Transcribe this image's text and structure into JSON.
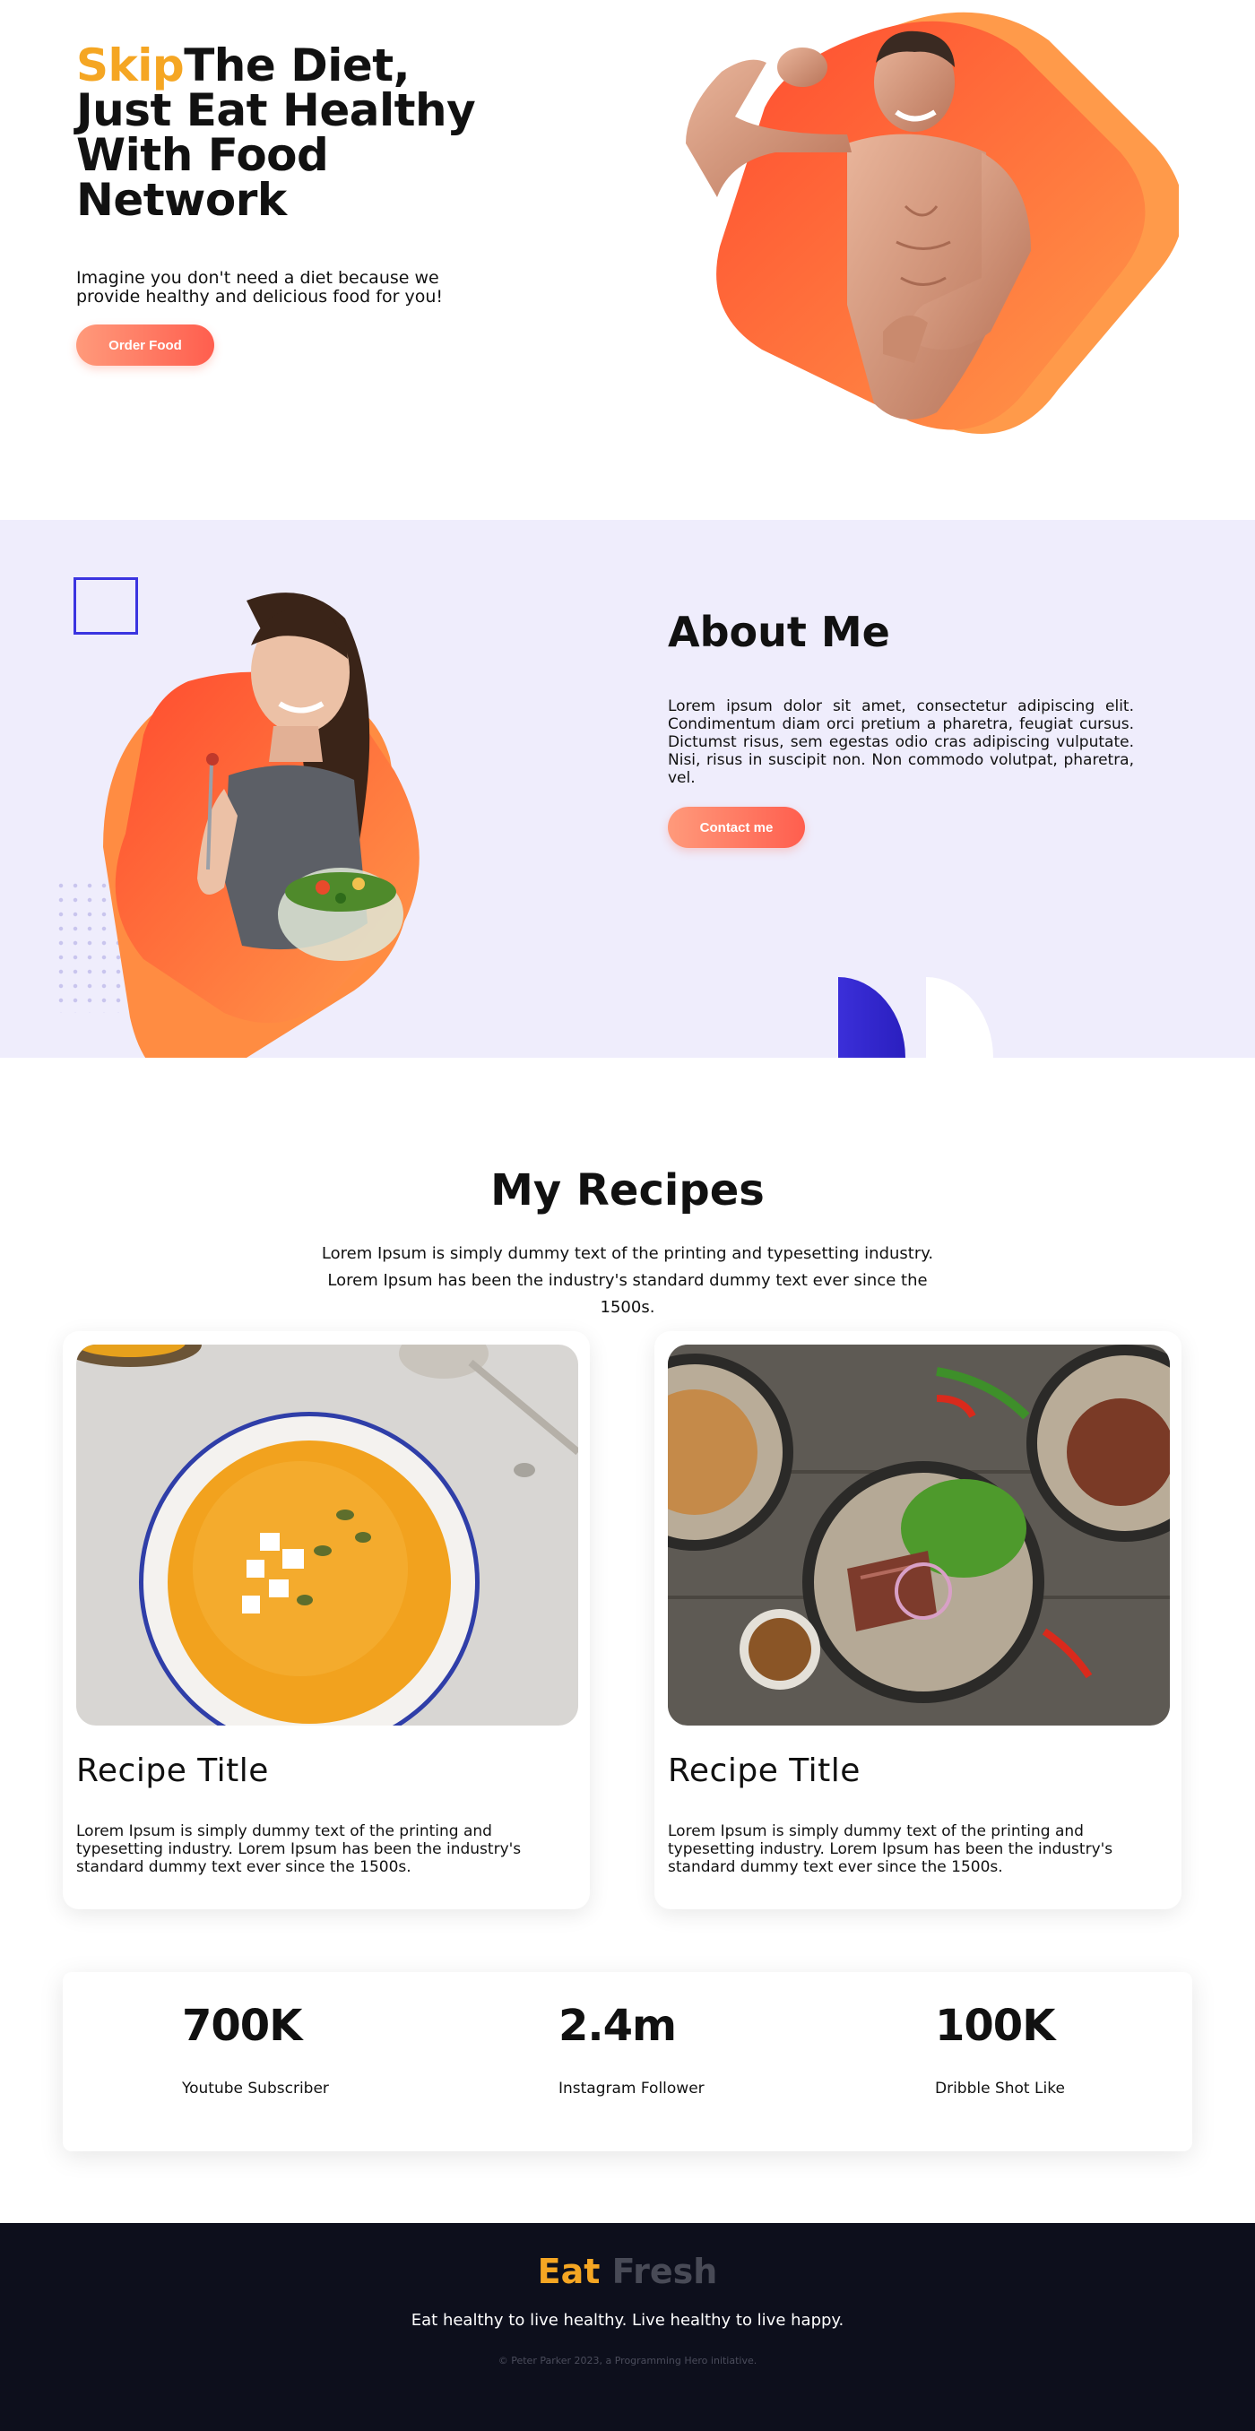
{
  "hero": {
    "title_accent": "Skip",
    "title_line1": "The Diet,",
    "title_line2": "Just Eat Healthy",
    "title_line3": "With Food Network",
    "description": "Imagine you don't need a diet because we provide healthy and delicious food for you!",
    "order_button": "Order Food",
    "image_alt": "fitness-man-photo"
  },
  "about": {
    "title": "About Me",
    "body": "Lorem ipsum dolor sit amet, consectetur adipiscing elit. Condimentum diam orci pretium a pharetra, feugiat cursus. Dictumst risus, sem egestas odio cras adipiscing vulputate. Nisi, risus in suscipit non. Non commodo volutpat, pharetra, vel.",
    "contact_button": "Contact me"
  },
  "recipes": {
    "title": "My Recipes",
    "description": "Lorem Ipsum is simply dummy text of the printing and typesetting industry. Lorem Ipsum has been the industry's standard dummy text ever since the 1500s.",
    "cards": [
      {
        "title": "Recipe Title",
        "text": "Lorem Ipsum is simply dummy text of the printing and typesetting industry. Lorem Ipsum has been the industry's standard dummy text ever since the 1500s."
      },
      {
        "title": "Recipe Title",
        "text": "Lorem Ipsum is simply dummy text of the printing and typesetting industry. Lorem Ipsum has been the industry's standard dummy text ever since the 1500s."
      }
    ]
  },
  "stats": [
    {
      "value": "700K",
      "label": "Youtube Subscriber"
    },
    {
      "value": "2.4m",
      "label": "Instagram Follower"
    },
    {
      "value": "100K",
      "label": "Dribble Shot Like"
    }
  ],
  "footer": {
    "brand_part1": "Eat",
    "brand_part2": "Fresh",
    "tagline": "Eat healthy to live healthy. Live healthy to live happy.",
    "copyright": "© Peter Parker 2023, a Programming Hero initiative."
  },
  "colors": {
    "accent": "#f5a623",
    "button_gradient_start": "#ff9a7b",
    "button_gradient_end": "#ff5e4e",
    "about_bg": "#efedfc",
    "footer_bg": "#0d0f1c",
    "shape_blue": "#3b34e0"
  }
}
